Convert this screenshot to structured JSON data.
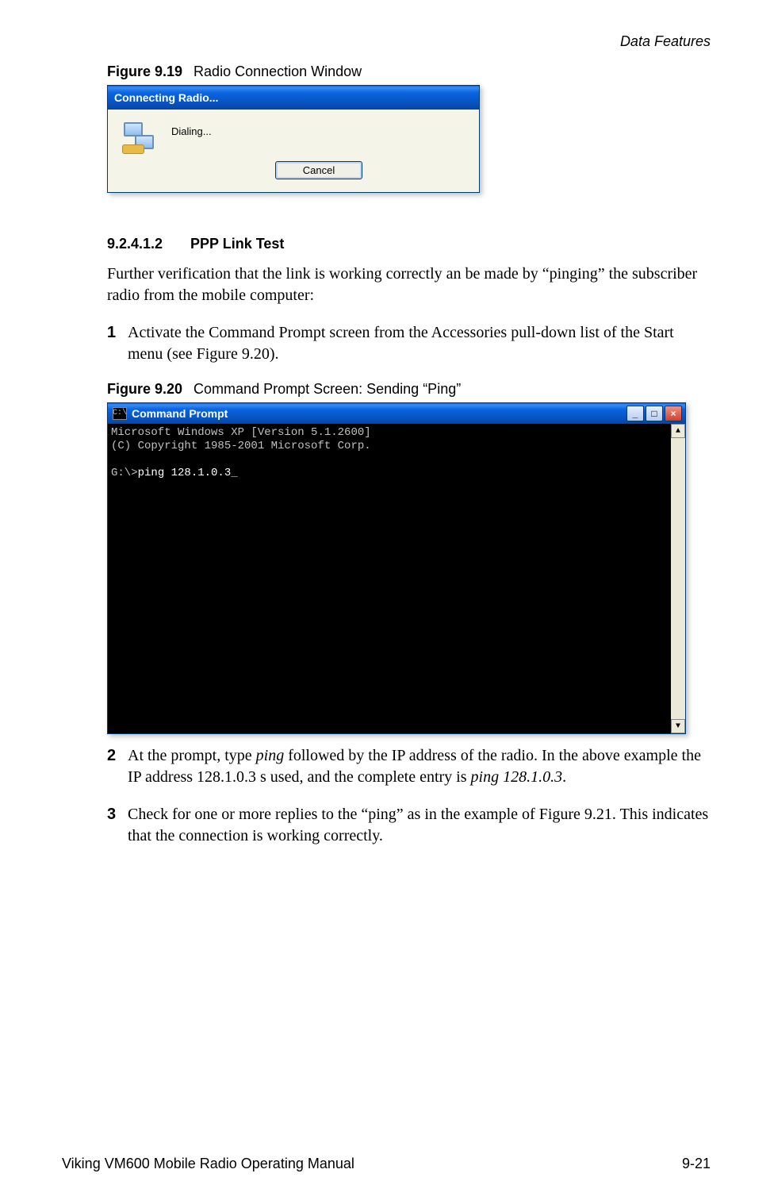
{
  "header": {
    "text": "Data Features"
  },
  "figure19": {
    "label": "Figure 9.19",
    "title": "Radio Connection Window",
    "dialog": {
      "title": "Connecting Radio...",
      "status": "Dialing...",
      "cancel": "Cancel"
    }
  },
  "section": {
    "number": "9.2.4.1.2",
    "title": "PPP Link Test"
  },
  "intro": "Further verification that the link is working correctly an be made by “pinging” the subscriber radio from the mobile computer:",
  "steps": {
    "s1": {
      "num": "1",
      "text": "Activate the Command Prompt screen from the Accessories pull-down list of the Start menu (see Figure 9.20)."
    },
    "s2": {
      "num": "2",
      "prefix": "At the prompt, type ",
      "italic1": "ping",
      "mid": " followed by the IP address of the radio. In the above example the IP address 128.1.0.3 s used, and the complete entry is ",
      "italic2": "ping 128.1.0.3",
      "suffix": "."
    },
    "s3": {
      "num": "3",
      "text": "Check for one or more replies to the “ping” as in the example of Figure 9.21. This indicates that the connection is working correctly."
    }
  },
  "figure20": {
    "label": "Figure 9.20",
    "title": "Command Prompt Screen: Sending “Ping”",
    "cmd": {
      "icon": "C:\\",
      "title": "Command Prompt",
      "line1": "Microsoft Windows XP [Version 5.1.2600]",
      "line2": "(C) Copyright 1985-2001 Microsoft Corp.",
      "prompt": "G:\\>",
      "entry": "ping 128.1.0.3",
      "cursor": "_",
      "min": "_",
      "max": "□",
      "close": "×",
      "up": "▲",
      "down": "▼"
    }
  },
  "footer": {
    "left": "Viking VM600 Mobile Radio Operating Manual",
    "right": "9-21"
  }
}
